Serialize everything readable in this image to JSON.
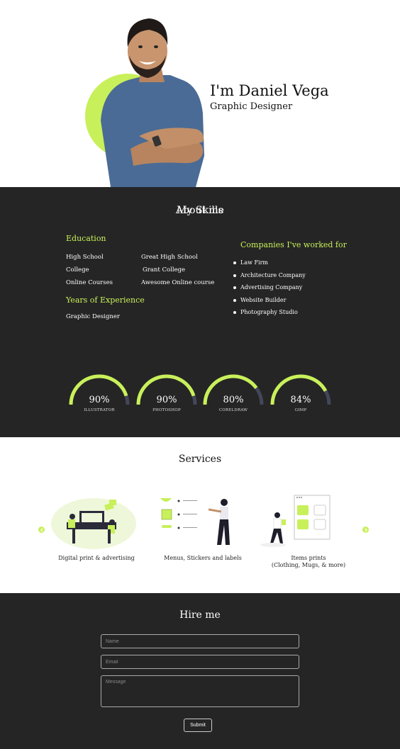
{
  "hero": {
    "name": "I'm Daniel Vega",
    "role": "Graphic Designer"
  },
  "about": {
    "title": "About me",
    "education_title": "Education",
    "education": [
      {
        "level": "High School",
        "institution": "Great High School"
      },
      {
        "level": "College",
        "institution": "Grant College"
      },
      {
        "level": "Online Courses",
        "institution": "Awesome Online course"
      }
    ],
    "years_title": "Years of Experience",
    "years_item": "Graphic Designer",
    "companies_title": "Companies I've worked for",
    "companies": [
      "Law Firm",
      "Architecture Company",
      "Advertising Company",
      "Website Builder",
      "Photography Studio"
    ]
  },
  "skills": {
    "title": "My Skills",
    "items": [
      {
        "percent_label": "90%",
        "name": "ILLUSTRATOR",
        "value": 90
      },
      {
        "percent_label": "90%",
        "name": "PHOTOSHOP",
        "value": 90
      },
      {
        "percent_label": "80%",
        "name": "CORELDRAW",
        "value": 80
      },
      {
        "percent_label": "84%",
        "name": "GIMP",
        "value": 84
      }
    ],
    "accent_color": "#c8f05a",
    "track_color": "#44475a"
  },
  "services": {
    "title": "Services",
    "items": [
      {
        "caption": "Digital print & advertising"
      },
      {
        "caption": "Menus, Stickers and labels"
      },
      {
        "caption_line1": "Items prints",
        "caption_line2": "(Clothing, Mugs, & more)"
      }
    ]
  },
  "hire": {
    "title": "Hire me",
    "name_placeholder": "Name",
    "email_placeholder": "Email",
    "message_placeholder": "Message",
    "submit_label": "Submit"
  },
  "colors": {
    "accent": "#c8f05a",
    "dark_bg": "#252525"
  }
}
